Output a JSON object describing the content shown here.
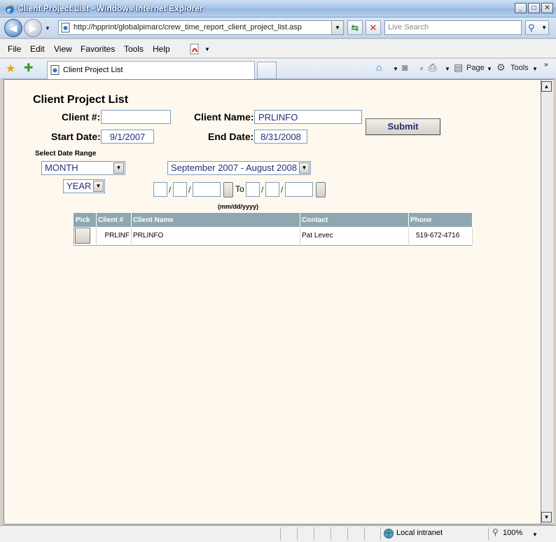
{
  "window": {
    "title": "Client Project List - Windows Internet Explorer"
  },
  "address": {
    "url": "http://hpprint/globalpimarc/crew_time_report_client_project_list.asp",
    "search_placeholder": "Live Search"
  },
  "menu": [
    "File",
    "Edit",
    "View",
    "Favorites",
    "Tools",
    "Help"
  ],
  "tab": {
    "label": "Client Project List"
  },
  "commandbar": {
    "page": "Page",
    "tools": "Tools"
  },
  "form": {
    "title": "Client Project List",
    "client_num_label": "Client #:",
    "client_num_value": "",
    "client_name_label": "Client Name:",
    "client_name_value": "PRLINFO",
    "start_date_label": "Start Date:",
    "start_date_value": "9/1/2007",
    "end_date_label": "End Date:",
    "end_date_value": "8/31/2008",
    "submit_label": "Submit",
    "range_label": "Select Date Range",
    "range_type": "MONTH",
    "period_select": "September 2007 - August 2008",
    "period_unit": "YEAR",
    "to_label": "To",
    "slash": "/",
    "date_format": "(mm/dd/yyyy)"
  },
  "table": {
    "headers": [
      "Pick",
      "Client #",
      "Client Name",
      "Contact",
      "Phone"
    ],
    "rows": [
      {
        "client_num": "PRLINF",
        "client_name": "PRLINFO",
        "contact": "Pat Levec",
        "phone": "519-672-4716"
      }
    ]
  },
  "statusbar": {
    "zone": "Local intranet",
    "zoom": "100%"
  }
}
